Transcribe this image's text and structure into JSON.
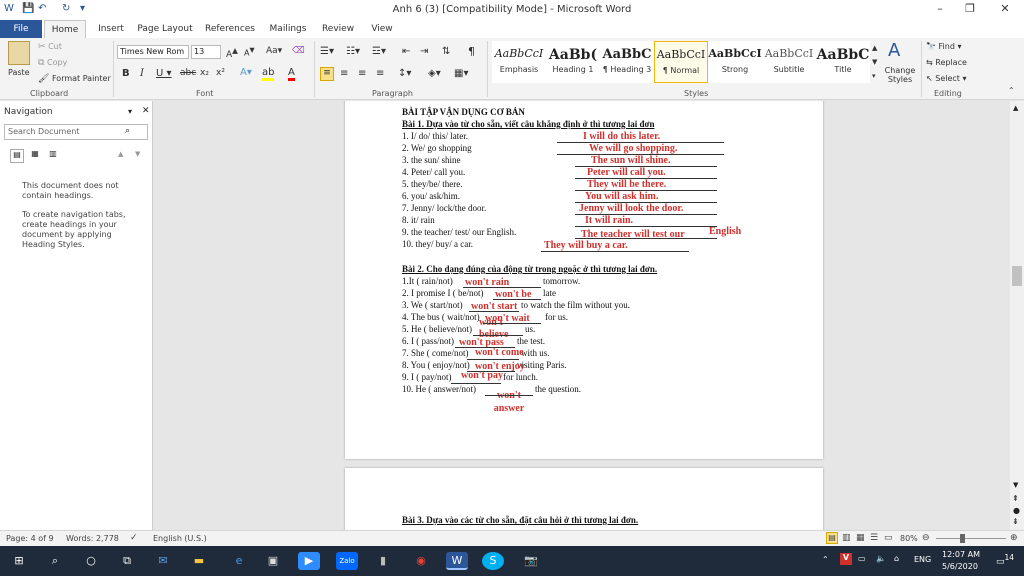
{
  "window": {
    "title": "Anh 6 (3) [Compatibility Mode]  -  Microsoft Word",
    "controls": [
      "–",
      "❐",
      "✕"
    ]
  },
  "tabs": [
    "File",
    "Home",
    "Insert",
    "Page Layout",
    "References",
    "Mailings",
    "Review",
    "View"
  ],
  "ribbon": {
    "clipboard": {
      "paste": "Paste",
      "cut": "Cut",
      "copy": "Copy",
      "format_painter": "Format Painter",
      "label": "Clipboard"
    },
    "font": {
      "name": "Times New Rom",
      "size": "13",
      "label": "Font"
    },
    "paragraph": {
      "label": "Paragraph"
    },
    "styles": {
      "label": "Styles",
      "items": [
        {
          "sample": "AaBbCcI",
          "name": "Emphasis"
        },
        {
          "sample": "AaBb(",
          "name": "Heading 1"
        },
        {
          "sample": "AaBbC",
          "name": "¶ Heading 3"
        },
        {
          "sample": "AaBbCcI",
          "name": "¶ Normal"
        },
        {
          "sample": "AaBbCcI",
          "name": "Strong"
        },
        {
          "sample": "AaBbCcI",
          "name": "Subtitle"
        },
        {
          "sample": "AaBbC",
          "name": "Title"
        }
      ],
      "change_styles": "Change Styles"
    },
    "editing": {
      "find": "Find",
      "replace": "Replace",
      "select": "Select",
      "label": "Editing"
    }
  },
  "nav": {
    "title": "Navigation",
    "search_placeholder": "Search Document",
    "msg1": "This document does not contain headings.",
    "msg2": "To create navigation tabs, create headings in your document by applying Heading Styles."
  },
  "document": {
    "heading": "BÀI TẬP VẬN DỤNG CƠ BẢN",
    "ex1_title": "Bài 1. Dựa vào từ cho sẵn, viết câu khẳng định ở thì tương lai đơn",
    "ex1": [
      {
        "q": "1. I/ do/ this/ later.",
        "a": "I will do this later."
      },
      {
        "q": "2. We/ go shopping",
        "a": "We will go shopping."
      },
      {
        "q": "3. the sun/ shine",
        "a": "The sun will shine."
      },
      {
        "q": "4. Peter/ call you.",
        "a": "Peter will call you."
      },
      {
        "q": "5. they/be/ there.",
        "a": "They will be there."
      },
      {
        "q": "6. you/ ask/him.",
        "a": "You will ask him."
      },
      {
        "q": "7. Jenny/ lock/the door.",
        "a": "Jenny will look the door."
      },
      {
        "q": "8. it/ rain",
        "a": "It will rain."
      },
      {
        "q": "9. the teacher/ test/ our English.",
        "a": "The teacher will test our",
        "a2": "English"
      },
      {
        "q": "10. they/ buy/ a car.",
        "a": "They will buy a car."
      }
    ],
    "ex2_title": "Bài 2. Cho dạng đúng của động từ trong ngoặc ở thì tương lai đơn.",
    "ex2": [
      {
        "q": "1.It ( rain/not)",
        "tail": "tomorrow.",
        "a": "won't rain"
      },
      {
        "q": "2. I  promise I ( be/not)",
        "tail": "late",
        "a": "won't be"
      },
      {
        "q": "3. We ( start/not)",
        "tail": "to watch the film without you.",
        "a": "won't start"
      },
      {
        "q": "4. The bus ( wait/not)",
        "tail": "for us.",
        "a": "won't wait"
      },
      {
        "q": "5. He ( believe/not)",
        "tail": "us.",
        "a": "won't believe"
      },
      {
        "q": "6. I ( pass/not)",
        "tail": "the test.",
        "a": "won't pass"
      },
      {
        "q": "7. She ( come/not)",
        "tail": "with us.",
        "a": "won't come"
      },
      {
        "q": "8. You ( enjoy/not)",
        "tail": "visiting Paris.",
        "a": "won't enjoy"
      },
      {
        "q": "9. I ( pay/not)",
        "tail": "for lunch.",
        "a": "won't pay"
      },
      {
        "q": "10. He ( answer/not)",
        "tail": "the question.",
        "a": "won't answer"
      }
    ],
    "ex3_title": "Bài 3. Dựa vào các từ cho sẵn, đặt câu hỏi ở thì tương lai đơn."
  },
  "status": {
    "page": "Page: 4 of 9",
    "words": "Words: 2,778",
    "lang": "English (U.S.)",
    "zoom": "80%"
  },
  "taskbar": {
    "lang": "ENG",
    "time": "12:07 AM",
    "date": "5/6/2020",
    "notifications": "14"
  }
}
